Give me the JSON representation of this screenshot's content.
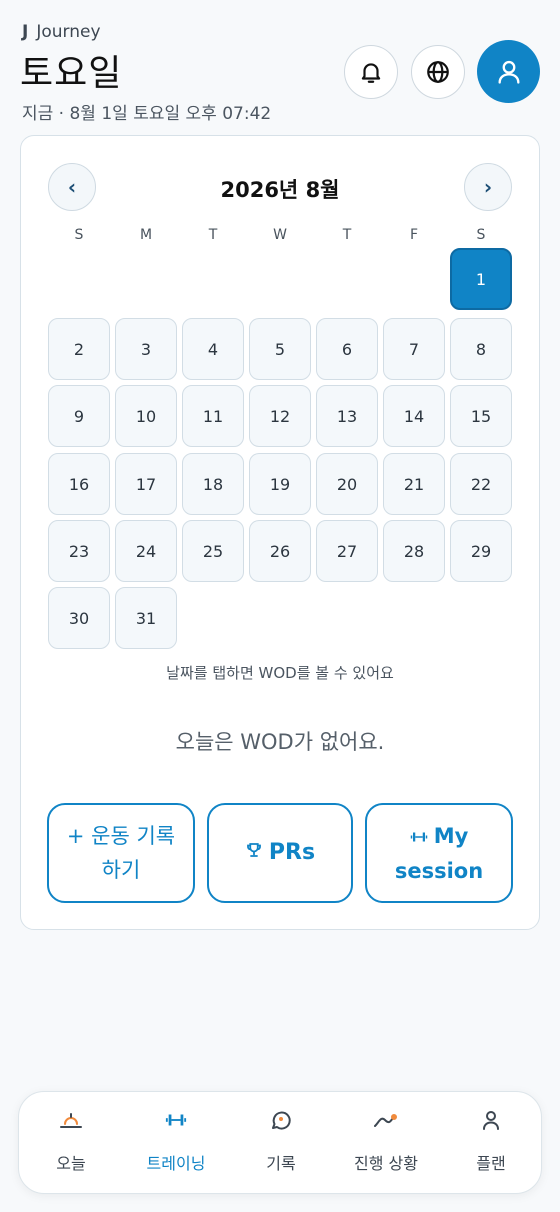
{
  "header": {
    "brand_mark": "J",
    "brand_name": "Journey",
    "day_title": "토요일",
    "now_text": "지금 · 8월 1일 토요일 오후 07:42",
    "icons": [
      "bell-icon",
      "globe-icon",
      "user-icon"
    ]
  },
  "calendar": {
    "prev": "‹",
    "next": "›",
    "month_label": "2026년 8월",
    "weekdays": [
      "S",
      "M",
      "T",
      "W",
      "T",
      "F",
      "S"
    ],
    "days": [
      "1",
      "2",
      "3",
      "4",
      "5",
      "6",
      "7",
      "8",
      "9",
      "10",
      "11",
      "12",
      "13",
      "14",
      "15",
      "16",
      "17",
      "18",
      "19",
      "20",
      "21",
      "22",
      "23",
      "24",
      "25",
      "26",
      "27",
      "28",
      "29",
      "30",
      "31"
    ],
    "selected_day": "1",
    "hint": "날짜를 탭하면 WOD를 볼 수 있어요",
    "empty_message": "오늘은 WOD가 없어요."
  },
  "actions": {
    "log_workout": "+ 운동 기록하기",
    "prs": "PRs",
    "my_session": "My session"
  },
  "bottom_nav": {
    "items": [
      {
        "label": "오늘",
        "icon": "sunrise-icon"
      },
      {
        "label": "트레이닝",
        "icon": "dumbbell-icon"
      },
      {
        "label": "기록",
        "icon": "chat-icon"
      },
      {
        "label": "진행 상황",
        "icon": "trend-icon"
      },
      {
        "label": "플랜",
        "icon": "person-icon"
      }
    ],
    "active_index": 1
  },
  "colors": {
    "accent": "#1084c6",
    "sunrise_accent": "#f08a3c"
  }
}
